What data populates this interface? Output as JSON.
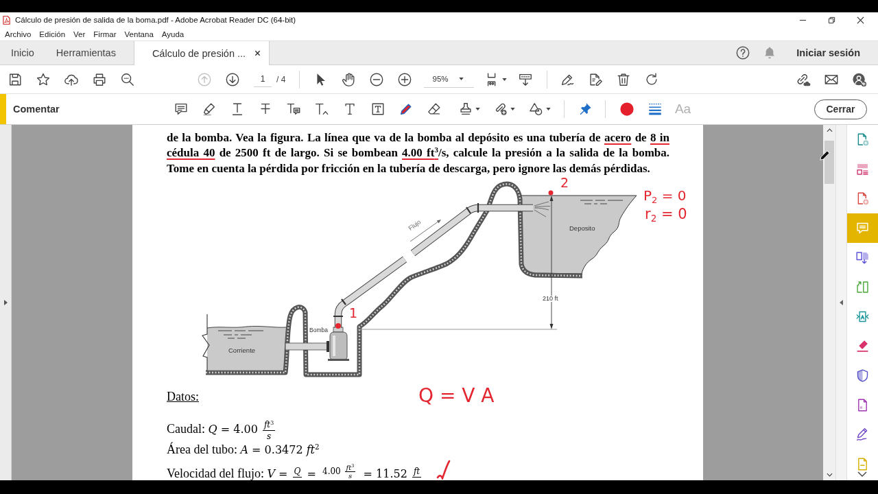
{
  "window": {
    "title": "Cálculo de presión de salida de la boma.pdf - Adobe Acrobat Reader DC (64-bit)"
  },
  "menu": [
    "Archivo",
    "Edición",
    "Ver",
    "Firmar",
    "Ventana",
    "Ayuda"
  ],
  "tabs": [
    {
      "label": "Inicio",
      "selected": false,
      "closable": false
    },
    {
      "label": "Herramientas",
      "selected": false,
      "closable": false
    },
    {
      "label": "Cálculo de presión ...",
      "selected": true,
      "closable": true
    }
  ],
  "account": {
    "sign_in": "Iniciar sesión"
  },
  "toolbar": {
    "page_up": {
      "disabled": true
    },
    "page_down": {
      "disabled": false
    },
    "page_current": "1",
    "page_total": "/ 4",
    "zoom": "95%"
  },
  "comment_bar": {
    "title": "Comentar",
    "font_tool": "Aa",
    "close_button": "Cerrar"
  },
  "document": {
    "problem": [
      {
        "text": "de la bomba. Vea la figura. La línea que va de la bomba al depósito es una tubería de ",
        "ink_underline": false
      },
      {
        "text": "acero",
        "ink_underline": true
      },
      {
        "text": " de ",
        "ink_underline": false
      },
      {
        "text": "8 in",
        "ink_underline": true
      },
      {
        "text": " cédula 40",
        "ink_underline": true
      },
      {
        "text": " de 2500 ft de largo. Si se bombean ",
        "ink_underline": false
      },
      {
        "text": "4.00 ft$^{3}$",
        "ink_underline": true
      },
      {
        "text": "/s, calcule la presión a la salida de la bomba. Tome en cuenta la pérdida por fricción en la tubería de descarga, pero ignore las demás pérdidas.",
        "ink_underline": false
      }
    ],
    "figure": {
      "flow_label": "Flujo",
      "reservoir_label": "Deposito",
      "height_label": "210 ft",
      "pump_label": "Bomba",
      "stream_label": "Corriente"
    },
    "ink": {
      "point_2": "2",
      "point_1": "1",
      "note_1": "P$_{2}$ = 0",
      "note_2": "r$_{2}$ = 0",
      "equation": "Q = V A"
    },
    "datos": {
      "heading": "Datos:",
      "lines": [
        {
          "label": "Caudal:",
          "parts": [
            {
              "kind": "text",
              "text": "*Q* = 4.00 "
            },
            {
              "kind": "fraction",
              "numerator": [
                {
                  "kind": "text",
                  "text": "*ft*$^{3}$"
                }
              ],
              "denominator": [
                {
                  "kind": "text",
                  "text": "*s*"
                }
              ]
            }
          ]
        },
        {
          "label": "Área del tubo:",
          "parts": [
            {
              "kind": "text",
              "text": "*A* = 0.3472 *ft*$^{2}$"
            }
          ]
        },
        {
          "label": "Velocidad del flujo:",
          "parts": [
            {
              "kind": "text",
              "text": "*V* = "
            },
            {
              "kind": "fraction",
              "numerator": [
                {
                  "kind": "text",
                  "text": "*Q*"
                }
              ]
            },
            {
              "kind": "text",
              "text": " = "
            },
            {
              "kind": "fraction",
              "numerator": [
                {
                  "kind": "text",
                  "text": "4.00 "
                },
                {
                  "kind": "fraction",
                  "numerator": [
                    {
                      "kind": "text",
                      "text": "*ft*$^{3}$"
                    }
                  ],
                  "denominator": [
                    {
                      "kind": "text",
                      "text": "*s*"
                    }
                  ]
                }
              ]
            },
            {
              "kind": "text",
              "text": " = 11.52 "
            },
            {
              "kind": "fraction",
              "numerator": [
                {
                  "kind": "text",
                  "text": "*ft*"
                }
              ]
            }
          ]
        }
      ]
    }
  },
  "right_panel": {
    "tools": [
      {
        "selected": false
      },
      {
        "selected": false
      },
      {
        "selected": false
      },
      {
        "selected": true
      },
      {
        "selected": false
      },
      {
        "selected": false
      },
      {
        "selected": false
      },
      {
        "selected": false
      },
      {
        "selected": false
      },
      {
        "selected": false
      },
      {
        "selected": false
      },
      {
        "selected": false
      }
    ]
  }
}
